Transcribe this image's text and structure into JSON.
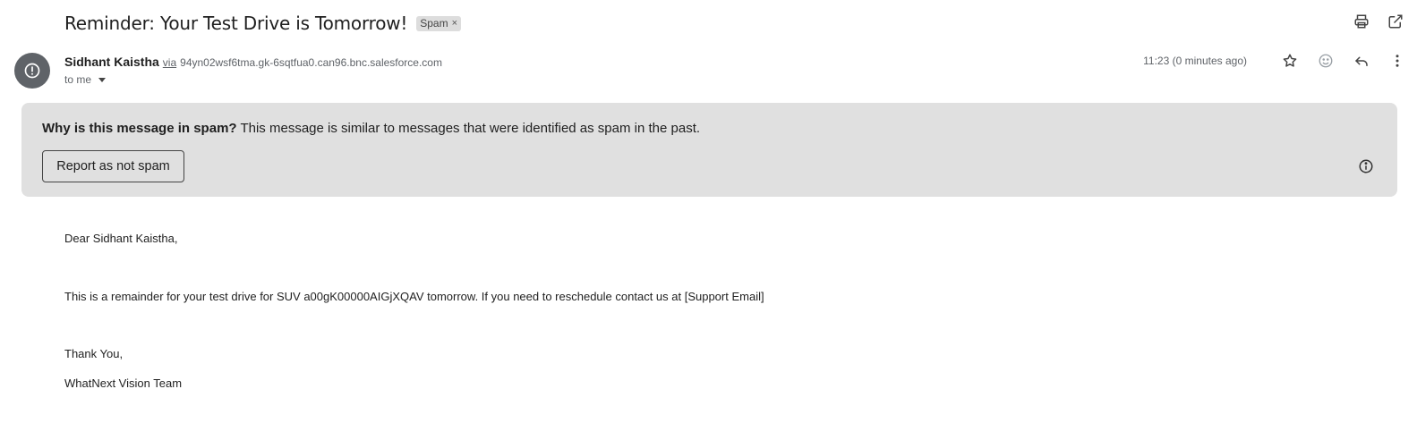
{
  "email": {
    "subject": "Reminder: Your Test Drive is Tomorrow!",
    "label_chip": "Spam",
    "label_chip_close": "×",
    "sender_name": "Sidhant Kaistha",
    "via_text": "via",
    "via_address": "94yn02wsf6tma.gk-6sqtfua0.can96.bnc.salesforce.com",
    "recipient": "to me",
    "timestamp": "11:23 (0 minutes ago)"
  },
  "icons": {
    "print": "print-icon",
    "open_new_window": "open-in-new-window-icon",
    "star": "star-icon",
    "emoji": "emoji-icon",
    "reply": "reply-icon",
    "more": "more-vert-icon",
    "avatar": "spam-alert-icon",
    "info": "info-icon"
  },
  "spam_banner": {
    "question": "Why is this message in spam?",
    "explanation": " This message is similar to messages that were identified as spam in the past.",
    "button_label": "Report as not spam"
  },
  "body": {
    "greeting": "Dear Sidhant Kaistha,",
    "paragraph": "This is a remainder for your test drive for SUV a00gK00000AIGjXQAV tomorrow. If you need to reschedule contact us at [Support Email]",
    "closing": "Thank You,",
    "signature": "WhatNext Vision Team"
  },
  "colors": {
    "banner_bg": "#e0e0e0",
    "avatar_bg": "#5f6368",
    "chip_bg": "#dddddd"
  }
}
